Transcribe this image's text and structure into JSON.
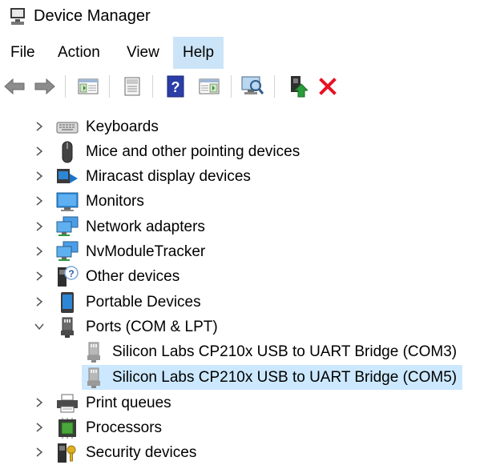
{
  "window": {
    "title": "Device Manager"
  },
  "menu": {
    "items": [
      {
        "label": "File"
      },
      {
        "label": "Action"
      },
      {
        "label": "View"
      },
      {
        "label": "Help",
        "active": true
      }
    ]
  },
  "toolbar": {
    "buttons": [
      "back-arrow-icon",
      "forward-arrow-icon",
      "properties-icon",
      "update-driver-icon",
      "help-icon",
      "console-icon",
      "scan-hardware-icon",
      "enable-device-icon",
      "uninstall-icon"
    ]
  },
  "tree": {
    "items": [
      {
        "label": "Keyboards",
        "icon": "keyboard-icon",
        "expanded": false
      },
      {
        "label": "Mice and other pointing devices",
        "icon": "mouse-icon",
        "expanded": false
      },
      {
        "label": "Miracast display devices",
        "icon": "miracast-icon",
        "expanded": false
      },
      {
        "label": "Monitors",
        "icon": "monitor-icon",
        "expanded": false
      },
      {
        "label": "Network adapters",
        "icon": "network-adapter-icon",
        "expanded": false
      },
      {
        "label": "NvModuleTracker",
        "icon": "network-adapter-icon",
        "expanded": false
      },
      {
        "label": "Other devices",
        "icon": "unknown-device-icon",
        "expanded": false
      },
      {
        "label": "Portable Devices",
        "icon": "portable-device-icon",
        "expanded": false
      },
      {
        "label": "Ports (COM & LPT)",
        "icon": "port-icon",
        "expanded": true
      },
      {
        "label": "Silicon Labs CP210x USB to UART Bridge (COM3)",
        "icon": "port-icon",
        "child": true
      },
      {
        "label": "Silicon Labs CP210x USB to UART Bridge (COM5)",
        "icon": "port-icon",
        "child": true,
        "selected": true
      },
      {
        "label": "Print queues",
        "icon": "printer-icon",
        "expanded": false
      },
      {
        "label": "Processors",
        "icon": "processor-icon",
        "expanded": false
      },
      {
        "label": "Security devices",
        "icon": "security-device-icon",
        "expanded": false
      }
    ]
  },
  "colors": {
    "selection": "#cce8ff",
    "menu_active": "#cce4f7",
    "uninstall_red": "#e81123",
    "help_blue": "#2b3ea8"
  }
}
